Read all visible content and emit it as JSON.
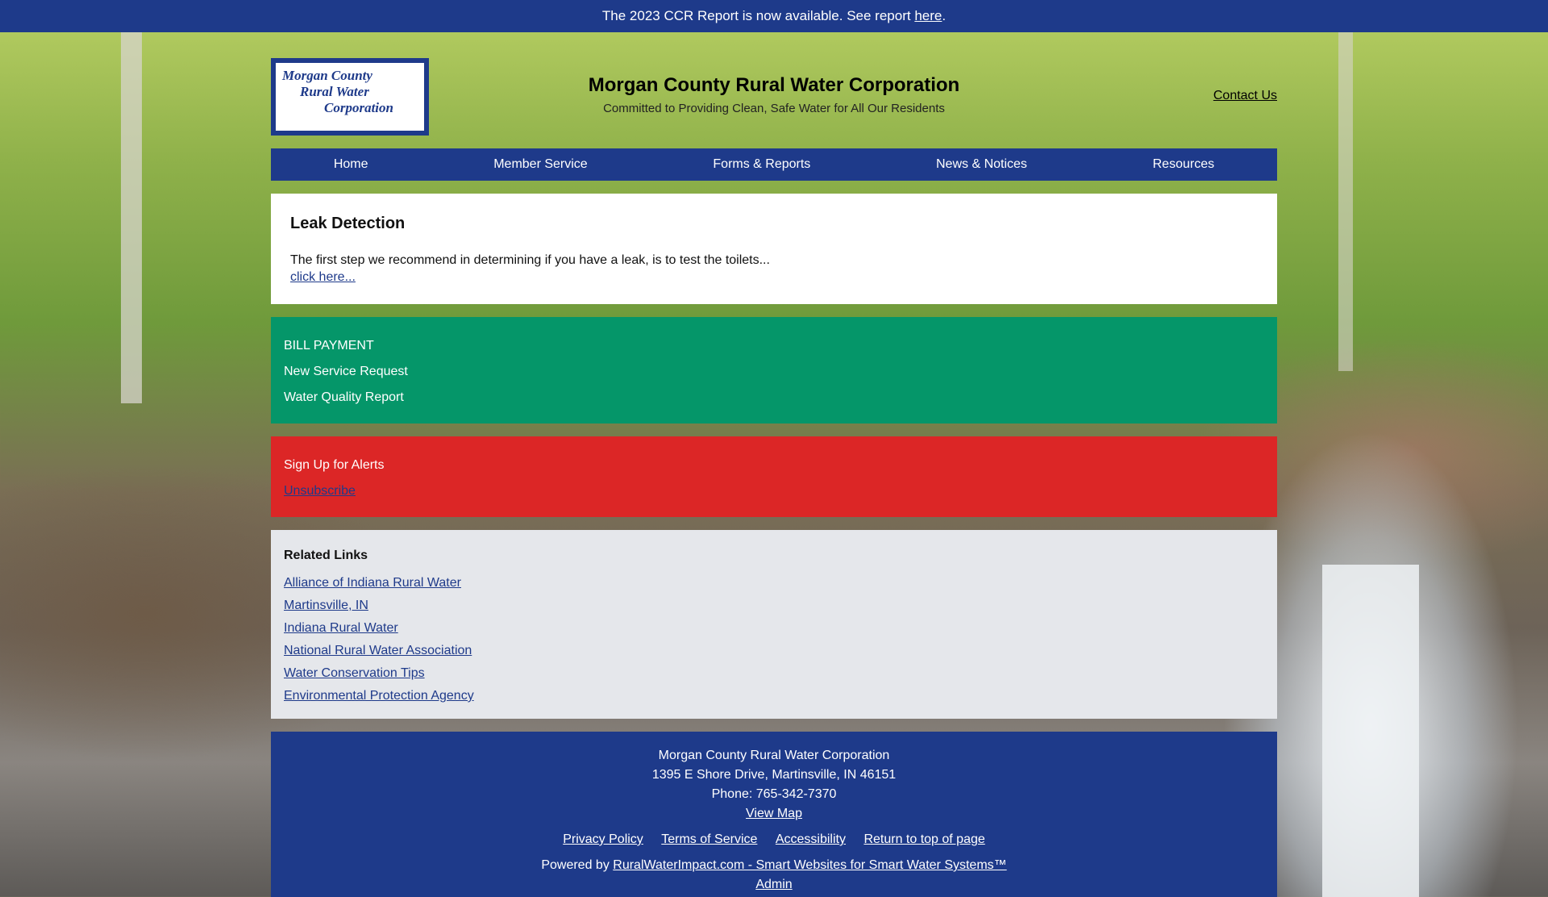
{
  "announcement": {
    "text": "The 2023 CCR Report is now available. See report ",
    "link_label": "here",
    "suffix": "."
  },
  "header": {
    "logo_lines": [
      "Morgan County",
      "Rural Water",
      "Corporation"
    ],
    "title": "Morgan County Rural Water Corporation",
    "tagline": "Committed to Providing Clean, Safe Water for All Our Residents",
    "contact_label": "Contact Us"
  },
  "nav": {
    "items": [
      {
        "label": "Home"
      },
      {
        "label": "Member Service"
      },
      {
        "label": "Forms & Reports"
      },
      {
        "label": "News & Notices"
      },
      {
        "label": "Resources"
      }
    ]
  },
  "leak": {
    "title": "Leak Detection",
    "body": "The first step we recommend in determining if you have a leak, is to test the toilets...",
    "link_label": "click here..."
  },
  "quick_links": {
    "items": [
      {
        "label": "BILL PAYMENT"
      },
      {
        "label": "New Service Request"
      },
      {
        "label": "Water Quality Report"
      }
    ]
  },
  "alerts": {
    "signup_label": "Sign Up for Alerts",
    "unsubscribe_label": "Unsubscribe"
  },
  "related": {
    "title": "Related Links",
    "items": [
      {
        "label": "Alliance of Indiana Rural Water"
      },
      {
        "label": "Martinsville, IN"
      },
      {
        "label": "Indiana Rural Water"
      },
      {
        "label": "National Rural Water Association"
      },
      {
        "label": "Water Conservation Tips"
      },
      {
        "label": "Environmental Protection Agency"
      }
    ]
  },
  "footer": {
    "org": "Morgan County Rural Water Corporation",
    "address": "1395 E Shore Drive, Martinsville, IN 46151",
    "phone": "Phone: 765-342-7370",
    "map_label": "View Map",
    "policy_links": [
      {
        "label": "Privacy Policy"
      },
      {
        "label": "Terms of Service"
      },
      {
        "label": "Accessibility"
      },
      {
        "label": "Return to top of page"
      }
    ],
    "powered_prefix": "Powered by ",
    "powered_link": "RuralWaterImpact.com - Smart Websites for Smart Water Systems™",
    "admin_label": "Admin"
  },
  "colors": {
    "brand_blue": "#1e3a8a",
    "green_panel": "#059669",
    "red_panel": "#dc2626",
    "links_panel": "#e5e7eb"
  }
}
